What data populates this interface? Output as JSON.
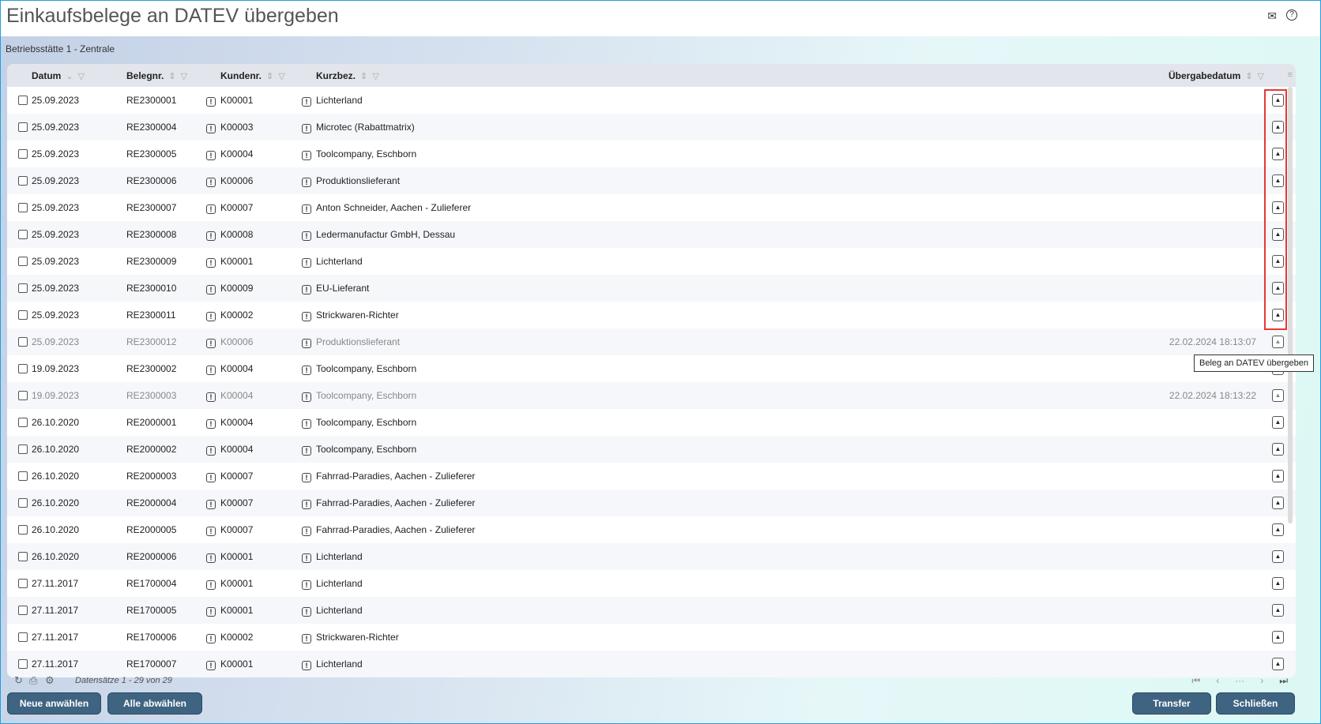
{
  "header": {
    "title": "Einkaufsbelege an DATEV übergeben",
    "subtitle": "Betriebsstätte 1 - Zentrale",
    "mail_icon": "✉",
    "help_icon": "?"
  },
  "columns": {
    "datum": "Datum",
    "belegnr": "Belegnr.",
    "kundennr": "Kundenr.",
    "kurzbez": "Kurzbez.",
    "uebergabe": "Übergabedatum"
  },
  "rows": [
    {
      "datum": "25.09.2023",
      "beleg": "RE2300001",
      "kunde": "K00001",
      "kurz": "Lichterland",
      "ueb": ""
    },
    {
      "datum": "25.09.2023",
      "beleg": "RE2300004",
      "kunde": "K00003",
      "kurz": "Microtec (Rabattmatrix)",
      "ueb": ""
    },
    {
      "datum": "25.09.2023",
      "beleg": "RE2300005",
      "kunde": "K00004",
      "kurz": "Toolcompany, Eschborn",
      "ueb": ""
    },
    {
      "datum": "25.09.2023",
      "beleg": "RE2300006",
      "kunde": "K00006",
      "kurz": "Produktionslieferant",
      "ueb": ""
    },
    {
      "datum": "25.09.2023",
      "beleg": "RE2300007",
      "kunde": "K00007",
      "kurz": "Anton Schneider, Aachen - Zulieferer",
      "ueb": ""
    },
    {
      "datum": "25.09.2023",
      "beleg": "RE2300008",
      "kunde": "K00008",
      "kurz": "Ledermanufactur GmbH, Dessau",
      "ueb": ""
    },
    {
      "datum": "25.09.2023",
      "beleg": "RE2300009",
      "kunde": "K00001",
      "kurz": "Lichterland",
      "ueb": ""
    },
    {
      "datum": "25.09.2023",
      "beleg": "RE2300010",
      "kunde": "K00009",
      "kurz": "EU-Lieferant",
      "ueb": ""
    },
    {
      "datum": "25.09.2023",
      "beleg": "RE2300011",
      "kunde": "K00002",
      "kurz": "Strickwaren-Richter",
      "ueb": ""
    },
    {
      "datum": "25.09.2023",
      "beleg": "RE2300012",
      "kunde": "K00006",
      "kurz": "Produktionslieferant",
      "ueb": "22.02.2024 18:13:07",
      "done": true
    },
    {
      "datum": "19.09.2023",
      "beleg": "RE2300002",
      "kunde": "K00004",
      "kurz": "Toolcompany, Eschborn",
      "ueb": ""
    },
    {
      "datum": "19.09.2023",
      "beleg": "RE2300003",
      "kunde": "K00004",
      "kurz": "Toolcompany, Eschborn",
      "ueb": "22.02.2024 18:13:22",
      "done": true
    },
    {
      "datum": "26.10.2020",
      "beleg": "RE2000001",
      "kunde": "K00004",
      "kurz": "Toolcompany, Eschborn",
      "ueb": ""
    },
    {
      "datum": "26.10.2020",
      "beleg": "RE2000002",
      "kunde": "K00004",
      "kurz": "Toolcompany, Eschborn",
      "ueb": ""
    },
    {
      "datum": "26.10.2020",
      "beleg": "RE2000003",
      "kunde": "K00007",
      "kurz": "Fahrrad-Paradies, Aachen - Zulieferer",
      "ueb": ""
    },
    {
      "datum": "26.10.2020",
      "beleg": "RE2000004",
      "kunde": "K00007",
      "kurz": "Fahrrad-Paradies, Aachen - Zulieferer",
      "ueb": ""
    },
    {
      "datum": "26.10.2020",
      "beleg": "RE2000005",
      "kunde": "K00007",
      "kurz": "Fahrrad-Paradies, Aachen - Zulieferer",
      "ueb": ""
    },
    {
      "datum": "26.10.2020",
      "beleg": "RE2000006",
      "kunde": "K00001",
      "kurz": "Lichterland",
      "ueb": ""
    },
    {
      "datum": "27.11.2017",
      "beleg": "RE1700004",
      "kunde": "K00001",
      "kurz": "Lichterland",
      "ueb": ""
    },
    {
      "datum": "27.11.2017",
      "beleg": "RE1700005",
      "kunde": "K00001",
      "kurz": "Lichterland",
      "ueb": ""
    },
    {
      "datum": "27.11.2017",
      "beleg": "RE1700006",
      "kunde": "K00002",
      "kurz": "Strickwaren-Richter",
      "ueb": ""
    },
    {
      "datum": "27.11.2017",
      "beleg": "RE1700007",
      "kunde": "K00001",
      "kurz": "Lichterland",
      "ueb": ""
    }
  ],
  "tooltip": "Beleg an DATEV übergeben",
  "footer": {
    "count": "Datensätze 1 - 29 von 29"
  },
  "buttons": {
    "neue": "Neue anwählen",
    "alle": "Alle abwählen",
    "transfer": "Transfer",
    "schliessen": "Schließen"
  }
}
